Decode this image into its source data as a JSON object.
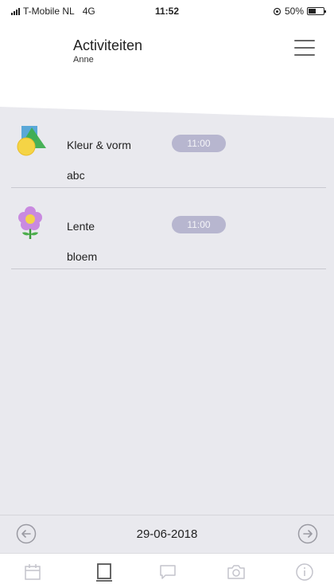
{
  "status_bar": {
    "carrier": "T-Mobile NL",
    "network": "4G",
    "time": "11:52",
    "battery": "50%",
    "battery_level": 0.5
  },
  "header": {
    "title": "Activiteiten",
    "subtitle": "Anne",
    "menu_icon": "hamburger-menu-icon"
  },
  "activities": [
    {
      "name": "Kleur & vorm",
      "time": "11:00",
      "description": "abc",
      "icon": "shapes-icon"
    },
    {
      "name": "Lente",
      "time": "11:00",
      "description": "bloem",
      "icon": "flower-icon"
    }
  ],
  "date_bar": {
    "date": "29-06-2018",
    "prev_icon": "arrow-left-circle-icon",
    "next_icon": "arrow-right-circle-icon"
  },
  "tabs": [
    {
      "icon": "calendar-icon",
      "active": false
    },
    {
      "icon": "book-icon",
      "active": true
    },
    {
      "icon": "chat-icon",
      "active": false
    },
    {
      "icon": "camera-icon",
      "active": false
    },
    {
      "icon": "info-icon",
      "active": false
    }
  ],
  "colors": {
    "background": "#e9e9ee",
    "time_pill": "#b7b6cf",
    "tab_active": "#555555",
    "tab_inactive": "#c4c4cc"
  }
}
